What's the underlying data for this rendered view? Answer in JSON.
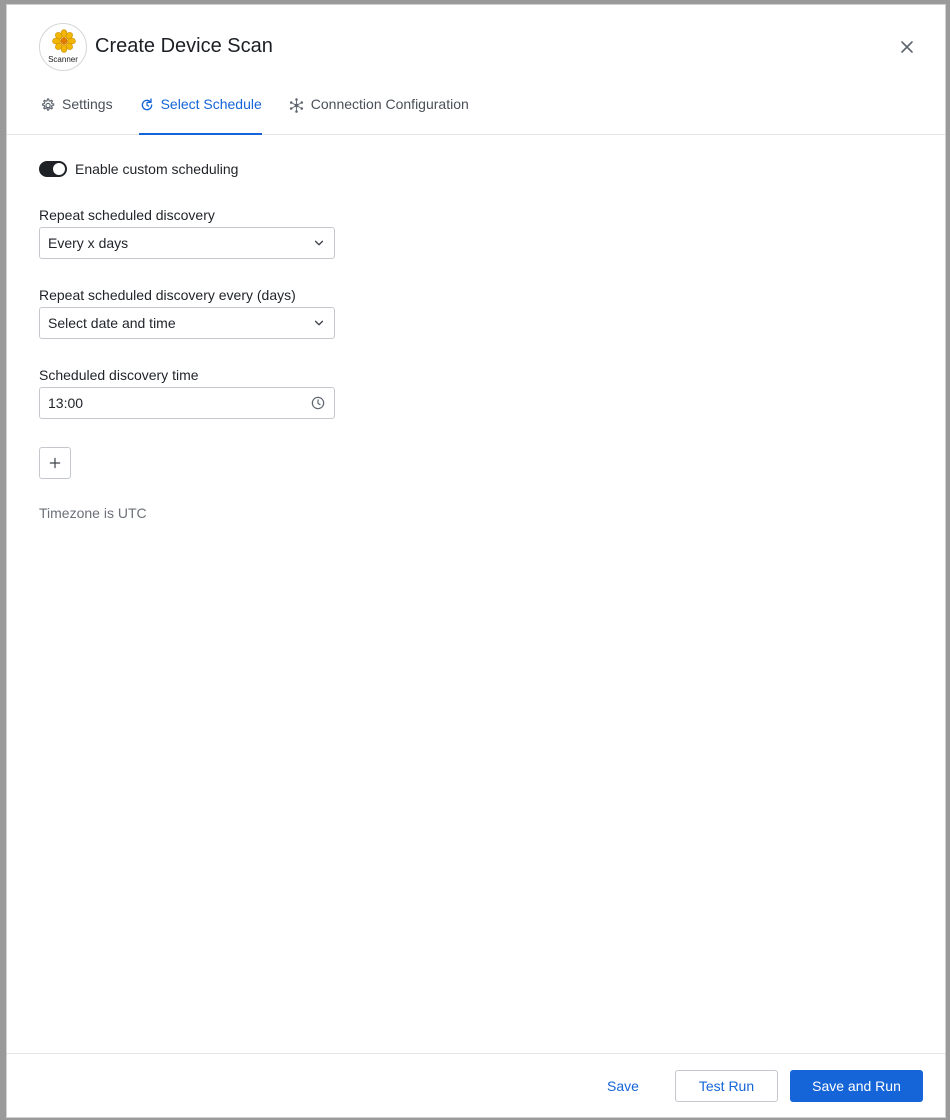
{
  "header": {
    "logo_text": "Scanner",
    "title": "Create Device Scan"
  },
  "tabs": [
    {
      "label": "Settings",
      "icon": "gear-icon",
      "active": false
    },
    {
      "label": "Select Schedule",
      "icon": "refresh-icon",
      "active": true
    },
    {
      "label": "Connection Configuration",
      "icon": "network-icon",
      "active": false
    }
  ],
  "schedule": {
    "toggle_label": "Enable custom scheduling",
    "toggle_on": true,
    "repeat_label": "Repeat scheduled discovery",
    "repeat_value": "Every x days",
    "every_label": "Repeat scheduled discovery every (days)",
    "every_value": "Select date and time",
    "time_label": "Scheduled discovery time",
    "time_value": "13:00",
    "timezone_note": "Timezone is UTC"
  },
  "footer": {
    "save_label": "Save",
    "test_label": "Test Run",
    "save_run_label": "Save and Run"
  },
  "colors": {
    "accent": "#1565d8",
    "logo_yellow": "#f2b705"
  }
}
